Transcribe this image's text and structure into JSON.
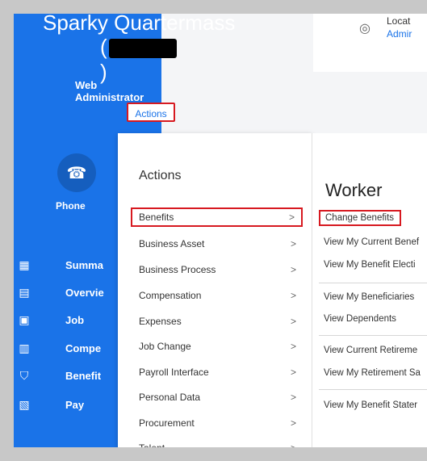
{
  "profile": {
    "name": "Sparky Quartermass",
    "paren_open": "(",
    "paren_close": ")",
    "role": "Web Administrator",
    "actions_button": "Actions",
    "phone_label": "Phone"
  },
  "location_card": {
    "title": "Locat",
    "link": "Admir"
  },
  "nav": [
    {
      "label": "Summa",
      "icon": "summary-grid-icon"
    },
    {
      "label": "Overvie",
      "icon": "overview-doc-icon"
    },
    {
      "label": "Job",
      "icon": "job-briefcase-icon"
    },
    {
      "label": "Compe",
      "icon": "compensation-chart-icon"
    },
    {
      "label": "Benefit",
      "icon": "benefits-shield-icon"
    },
    {
      "label": "Pay",
      "icon": "pay-icon"
    }
  ],
  "actions_menu": {
    "title": "Actions",
    "items": [
      {
        "label": "Benefits",
        "chevron": ">"
      },
      {
        "label": "Business Asset",
        "chevron": ">"
      },
      {
        "label": "Business Process",
        "chevron": ">"
      },
      {
        "label": "Compensation",
        "chevron": ">"
      },
      {
        "label": "Expenses",
        "chevron": ">"
      },
      {
        "label": "Job Change",
        "chevron": ">"
      },
      {
        "label": "Payroll Interface",
        "chevron": ">"
      },
      {
        "label": "Personal Data",
        "chevron": ">"
      },
      {
        "label": "Procurement",
        "chevron": ">"
      },
      {
        "label": "Talent",
        "chevron": ">"
      }
    ]
  },
  "worker_menu": {
    "title": "Worker",
    "items": [
      "Change Benefits",
      "View My Current Benef",
      "View My Benefit Electi",
      "View My Beneficiaries",
      "View Dependents",
      "View Current Retireme",
      "View My Retirement Sa",
      "View My Benefit Stater"
    ]
  },
  "colors": {
    "brand_blue": "#1a73e8",
    "highlight_red": "#d71920"
  }
}
